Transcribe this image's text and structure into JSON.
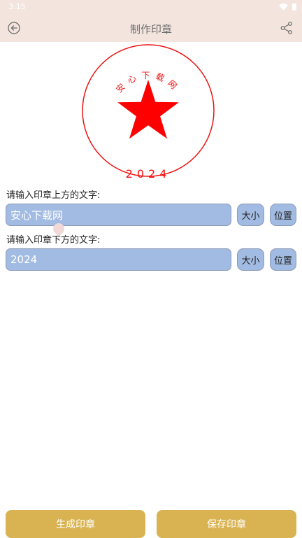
{
  "status": {
    "time": "3:15"
  },
  "header": {
    "title": "制作印章"
  },
  "seal": {
    "top_text": "安心下载网",
    "bottom_text": "2024",
    "color": "#ee1111"
  },
  "form": {
    "top_label": "请输入印章上方的文字:",
    "top_value": "安心下载网",
    "bottom_label": "请输入印章下方的文字:",
    "bottom_value": "2024",
    "size_label": "大小",
    "position_label": "位置"
  },
  "actions": {
    "generate_label": "生成印章",
    "save_label": "保存印章"
  },
  "colors": {
    "header_bg": "#f3e4de",
    "input_bg": "#a2bbe2",
    "action_bg": "#d9b352"
  }
}
